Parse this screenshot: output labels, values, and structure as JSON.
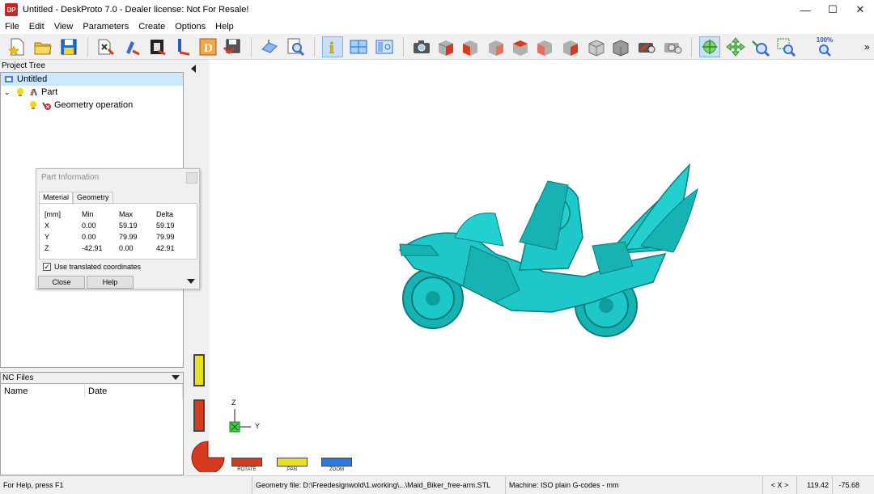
{
  "window": {
    "app_icon": "DP",
    "title": "Untitled - DeskProto 7.0 - Dealer license: Not For Resale!",
    "minimize": "—",
    "maximize": "☐",
    "close": "✕"
  },
  "menu": [
    "File",
    "Edit",
    "View",
    "Parameters",
    "Create",
    "Options",
    "Help"
  ],
  "toolbar": {
    "zoom_percent": "100%",
    "overflow": "»"
  },
  "project_tree": {
    "header": "Project Tree",
    "items": [
      {
        "label": "Untitled"
      },
      {
        "label": "Part"
      },
      {
        "label": "Geometry operation"
      }
    ]
  },
  "nc_files": {
    "header": "NC Files",
    "columns": [
      "Name",
      "Date"
    ]
  },
  "part_info": {
    "title": "Part Information",
    "tabs": [
      "Material",
      "Geometry"
    ],
    "headers": [
      "[mm]",
      "Min",
      "Max",
      "Delta"
    ],
    "rows": [
      {
        "axis": "X",
        "min": "0.00",
        "max": "59.19",
        "delta": "59.19"
      },
      {
        "axis": "Y",
        "min": "0.00",
        "max": "79.99",
        "delta": "79.99"
      },
      {
        "axis": "Z",
        "min": "-42.91",
        "max": "0.00",
        "delta": "42.91"
      }
    ],
    "checkbox_label": "Use translated coordinates",
    "checkbox_checked": true,
    "close_label": "Close",
    "help_label": "Help"
  },
  "viewport": {
    "axis_z": "Z",
    "axis_y": "Y",
    "mouse_modes": [
      {
        "label": "ROTATE",
        "color": "#d83a20"
      },
      {
        "label": "PAN",
        "color": "#e8e020"
      },
      {
        "label": "ZOOM",
        "color": "#2a7ae0"
      }
    ],
    "model_color": "#1ec8c8"
  },
  "status": {
    "help": "For Help, press F1",
    "geometry_file": "Geometry file: D:\\Freedesignwold\\1.working\\...\\Maid_Biker_free-arm.STL",
    "machine": "Machine: ISO plain G-codes - mm",
    "axis_nav": "< X >",
    "coord_1": "119.42",
    "coord_2": "-75.68"
  }
}
